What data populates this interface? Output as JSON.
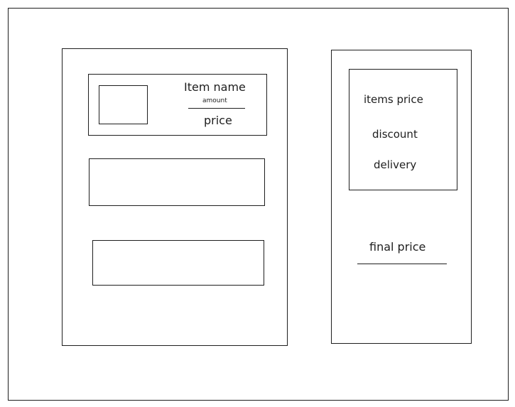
{
  "cart_item": {
    "name": "Item name",
    "amount": "amount",
    "price": "price"
  },
  "summary": {
    "items_price": "items price",
    "discount": "discount",
    "delivery": "delivery",
    "final_price": "final price"
  }
}
